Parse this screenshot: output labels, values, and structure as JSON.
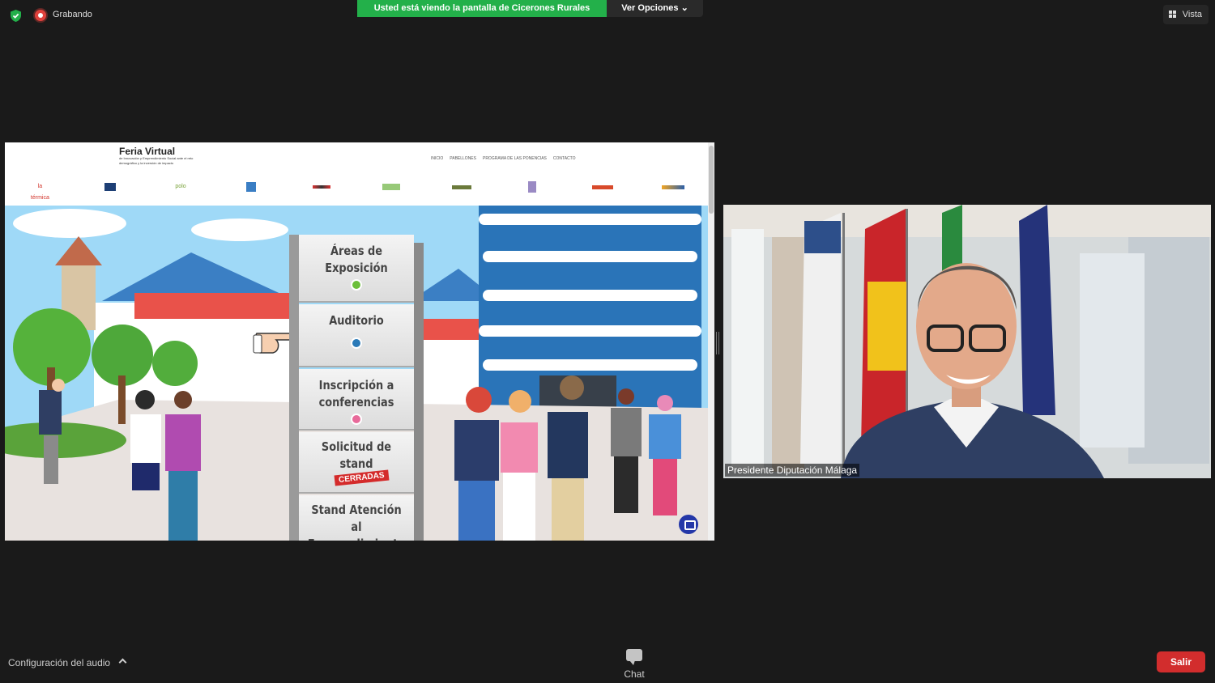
{
  "status": {
    "recording_label": "Grabando"
  },
  "share": {
    "banner_text": "Usted está viendo la pantalla de Cicerones Rurales",
    "options_label": "Ver Opciones ⌄"
  },
  "view": {
    "label": "Vista"
  },
  "website": {
    "title": "Feria Virtual",
    "subtitle": "de Innovación y Emprendimiento Social ante el reto demográfico y la inversión de impacto",
    "nav": [
      "INICIO",
      "PABELLONES",
      "PROGRAMA DE LAS PONENCIAS",
      "CONTACTO"
    ],
    "sponsors": [
      "la térmica",
      "",
      "polo",
      "",
      "",
      "",
      "",
      "",
      "",
      ""
    ],
    "signs": [
      {
        "label": "Áreas de Exposición"
      },
      {
        "label": "Auditorio"
      },
      {
        "label": "Inscripción a conferencias"
      },
      {
        "label": "Solicitud de stand",
        "stamp": "CERRADAS"
      },
      {
        "label": "Stand Atención al Emprendimiento Social"
      }
    ]
  },
  "video": {
    "participant_name": "Presidente Diputación Málaga"
  },
  "toolbar": {
    "audio_settings": "Configuración del audio",
    "chat_label": "Chat",
    "leave_label": "Salir"
  },
  "colors": {
    "banner_green": "#23b04a",
    "leave_red": "#d22d2d",
    "sky": "#9fd9f7",
    "building_blue": "#2a74b8",
    "sign_dot_green": "#6bbf3a",
    "sign_dot_blue": "#2a7ab8",
    "sign_dot_pink": "#e86a9a"
  },
  "icons": [
    "shield-check-icon",
    "record-icon",
    "grid-icon",
    "chat-icon",
    "chevron-up-icon",
    "chat-bubble-icon",
    "pointing-hand-icon"
  ]
}
